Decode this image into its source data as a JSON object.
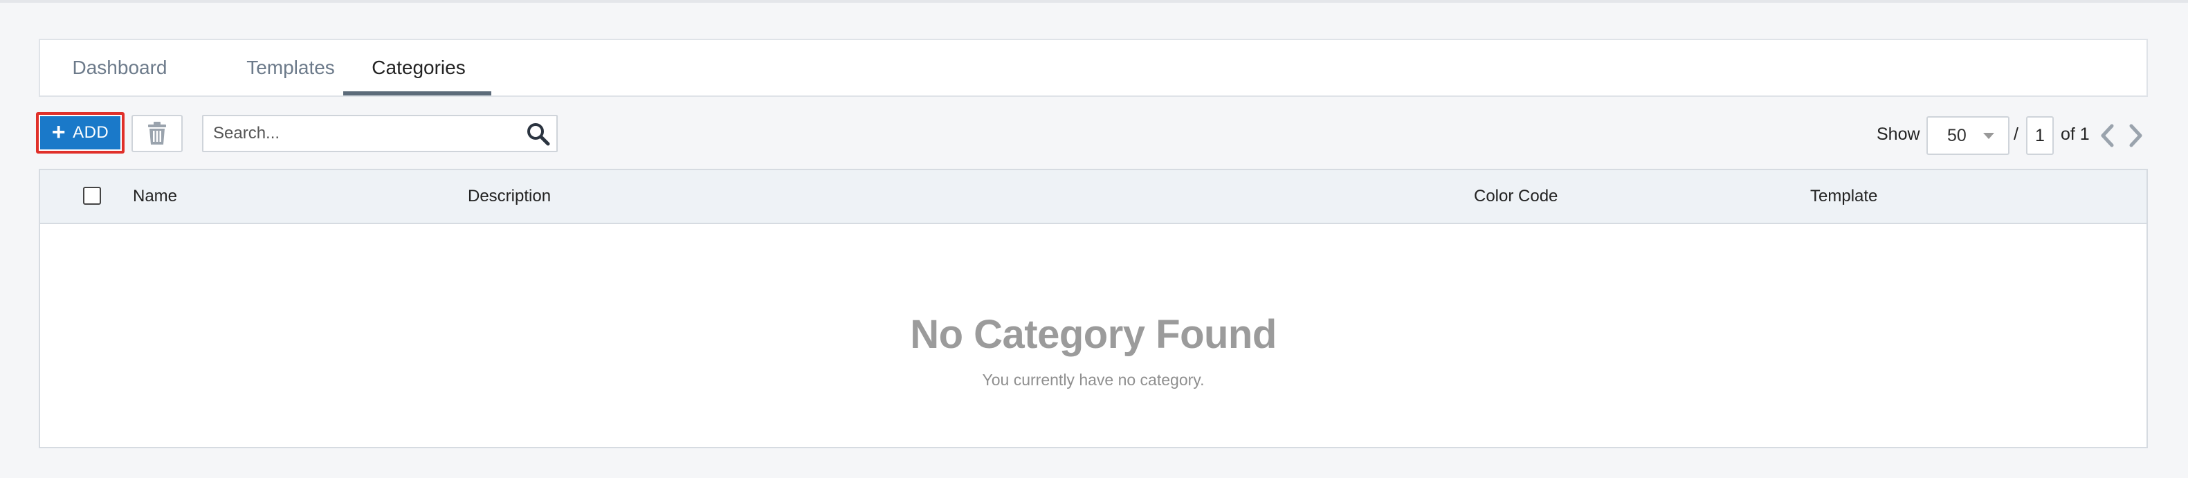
{
  "tabs": [
    {
      "label": "Dashboard",
      "active": false
    },
    {
      "label": "Templates",
      "active": false
    },
    {
      "label": "Categories",
      "active": true
    }
  ],
  "toolbar": {
    "add_label": "ADD",
    "add_icon": "plus-icon",
    "delete_icon": "trash-icon",
    "search_placeholder": "Search...",
    "search_value": "",
    "search_icon": "search-icon"
  },
  "pagination": {
    "show_label": "Show",
    "page_size": "50",
    "separator": "/",
    "current_page": "1",
    "of_label": "of 1",
    "prev_icon": "chevron-left-icon",
    "next_icon": "chevron-right-icon"
  },
  "table": {
    "columns": [
      "Name",
      "Description",
      "Color Code",
      "Template"
    ],
    "rows": [],
    "empty_title": "No Category Found",
    "empty_subtitle": "You currently have no category."
  },
  "colors": {
    "accent": "#1a79c9",
    "highlight_border": "#e0302a",
    "header_bg": "#eef2f6",
    "page_bg": "#f5f6f8"
  }
}
